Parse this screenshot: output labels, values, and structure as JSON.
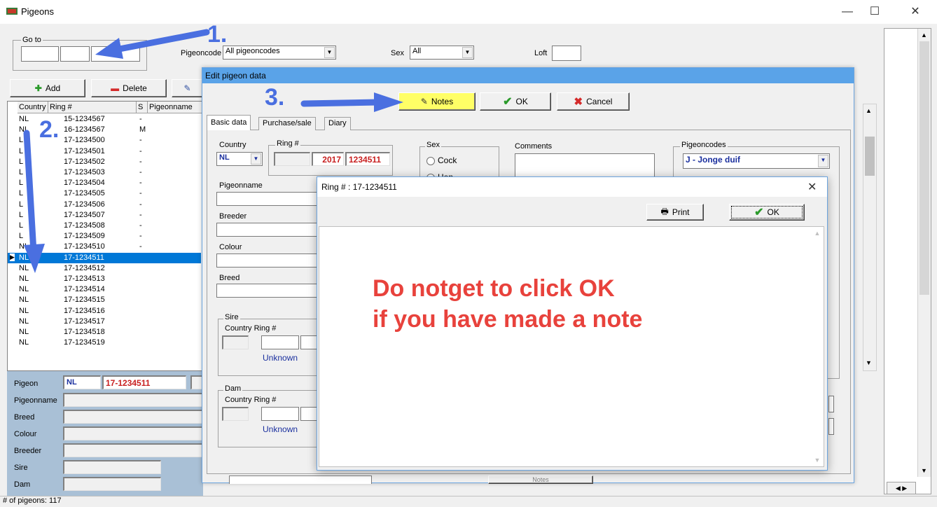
{
  "window": {
    "title": "Pigeons",
    "minimize": "—",
    "maximize": "☐",
    "close": "✕"
  },
  "goto": {
    "label": "Go to"
  },
  "filters": {
    "pigeoncode_label": "Pigeoncode",
    "pigeoncode_value": "All pigeoncodes",
    "sex_label": "Sex",
    "sex_value": "All",
    "loft_label": "Loft"
  },
  "toolbar": {
    "add_label": "Add",
    "delete_label": "Delete"
  },
  "grid": {
    "columns": [
      "Country",
      "Ring #",
      "S",
      "Pigeonname"
    ],
    "rows": [
      {
        "country": "NL",
        "ring": "15-1234567",
        "sex": "-"
      },
      {
        "country": "NL",
        "ring": "16-1234567",
        "sex": "M"
      },
      {
        "country": "L",
        "ring": "17-1234500",
        "sex": "-"
      },
      {
        "country": "L",
        "ring": "17-1234501",
        "sex": "-"
      },
      {
        "country": "L",
        "ring": "17-1234502",
        "sex": "-"
      },
      {
        "country": "L",
        "ring": "17-1234503",
        "sex": "-"
      },
      {
        "country": "L",
        "ring": "17-1234504",
        "sex": "-"
      },
      {
        "country": "L",
        "ring": "17-1234505",
        "sex": "-"
      },
      {
        "country": "L",
        "ring": "17-1234506",
        "sex": "-"
      },
      {
        "country": "L",
        "ring": "17-1234507",
        "sex": "-"
      },
      {
        "country": "L",
        "ring": "17-1234508",
        "sex": "-"
      },
      {
        "country": "L",
        "ring": "17-1234509",
        "sex": "-"
      },
      {
        "country": "NL",
        "ring": "17-1234510",
        "sex": "-"
      },
      {
        "country": "NL",
        "ring": "17-1234511",
        "sex": ""
      },
      {
        "country": "NL",
        "ring": "17-1234512",
        "sex": ""
      },
      {
        "country": "NL",
        "ring": "17-1234513",
        "sex": ""
      },
      {
        "country": "NL",
        "ring": "17-1234514",
        "sex": ""
      },
      {
        "country": "NL",
        "ring": "17-1234515",
        "sex": ""
      },
      {
        "country": "NL",
        "ring": "17-1234516",
        "sex": ""
      },
      {
        "country": "NL",
        "ring": "17-1234517",
        "sex": ""
      },
      {
        "country": "NL",
        "ring": "17-1234518",
        "sex": ""
      },
      {
        "country": "NL",
        "ring": "17-1234519",
        "sex": ""
      }
    ],
    "selected_index": 13
  },
  "details": {
    "pigeon_label": "Pigeon",
    "pigeon_country": "NL",
    "pigeon_ring": "17-1234511",
    "pigeonname_label": "Pigeonname",
    "breed_label": "Breed",
    "colour_label": "Colour",
    "breeder_label": "Breeder",
    "sire_label": "Sire",
    "dam_label": "Dam"
  },
  "status": {
    "count_text": "# of pigeons: 117"
  },
  "annotations": {
    "step1": "1.",
    "step2": "2.",
    "step3": "3."
  },
  "edit_dialog": {
    "title": "Edit pigeon data",
    "notes_label": "Notes",
    "ok_label": "OK",
    "cancel_label": "Cancel",
    "tabs": [
      "Basic data",
      "Purchase/sale",
      "Diary"
    ],
    "country_label": "Country",
    "country_value": "NL",
    "ring_label": "Ring #",
    "ring_year": "2017",
    "ring_number": "1234511",
    "sex_group": "Sex",
    "sex_cock": "Cock",
    "sex_hen": "Hen",
    "comments_label": "Comments",
    "pigeoncodes_label": "Pigeoncodes",
    "pigeoncodes_value": "J - Jonge duif",
    "pigeonname_label": "Pigeonname",
    "breeder_label": "Breeder",
    "colour_label": "Colour",
    "breed_label": "Breed",
    "sire_group": "Sire",
    "sire_country_ring": "Country Ring #",
    "sire_unknown": "Unknown",
    "dam_group": "Dam",
    "dam_country_ring": "Country Ring #",
    "dam_unknown": "Unknown",
    "bottom_notes": "Notes"
  },
  "notes_dialog": {
    "title": "Ring # : 17-1234511",
    "print_label": "Print",
    "ok_label": "OK",
    "message_line1": "Do notget to click OK",
    "message_line2": "if you have made a note"
  },
  "colors": {
    "accent": "#0078d7",
    "title_blue": "#5aa3e8",
    "red_text": "#e8423c",
    "arrow_blue": "#4a6fe0",
    "notes_yellow": "#ffff66"
  }
}
